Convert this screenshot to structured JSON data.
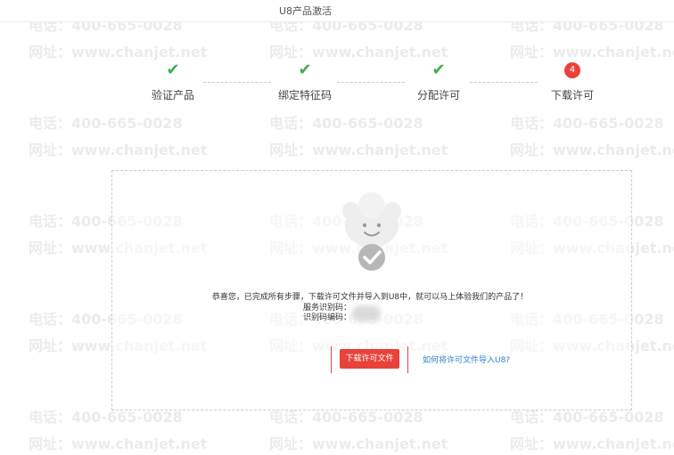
{
  "header": {
    "title": "U8产品激活"
  },
  "steps": [
    {
      "label": "验证产品",
      "state": "done",
      "icon": "check-icon"
    },
    {
      "label": "绑定特征码",
      "state": "done",
      "icon": "check-icon"
    },
    {
      "label": "分配许可",
      "state": "done",
      "icon": "check-icon"
    },
    {
      "label": "下载许可",
      "state": "current",
      "number": "4"
    }
  ],
  "watermark": {
    "phone": "电话：400-665-0028",
    "site": "网址：www.chanjet.net"
  },
  "panel": {
    "message": "恭喜您，已完成所有步骤，下载许可文件并导入到U8中，就可以马上体验我们的产品了！",
    "service_label": "服务识别码：",
    "customer_label": "识别码编码：",
    "download_button": "下载许可文件",
    "help_link": "如何将许可文件导入U8?"
  },
  "colors": {
    "accent": "#e8423b",
    "success": "#3fae49",
    "link": "#2f7fd0"
  }
}
